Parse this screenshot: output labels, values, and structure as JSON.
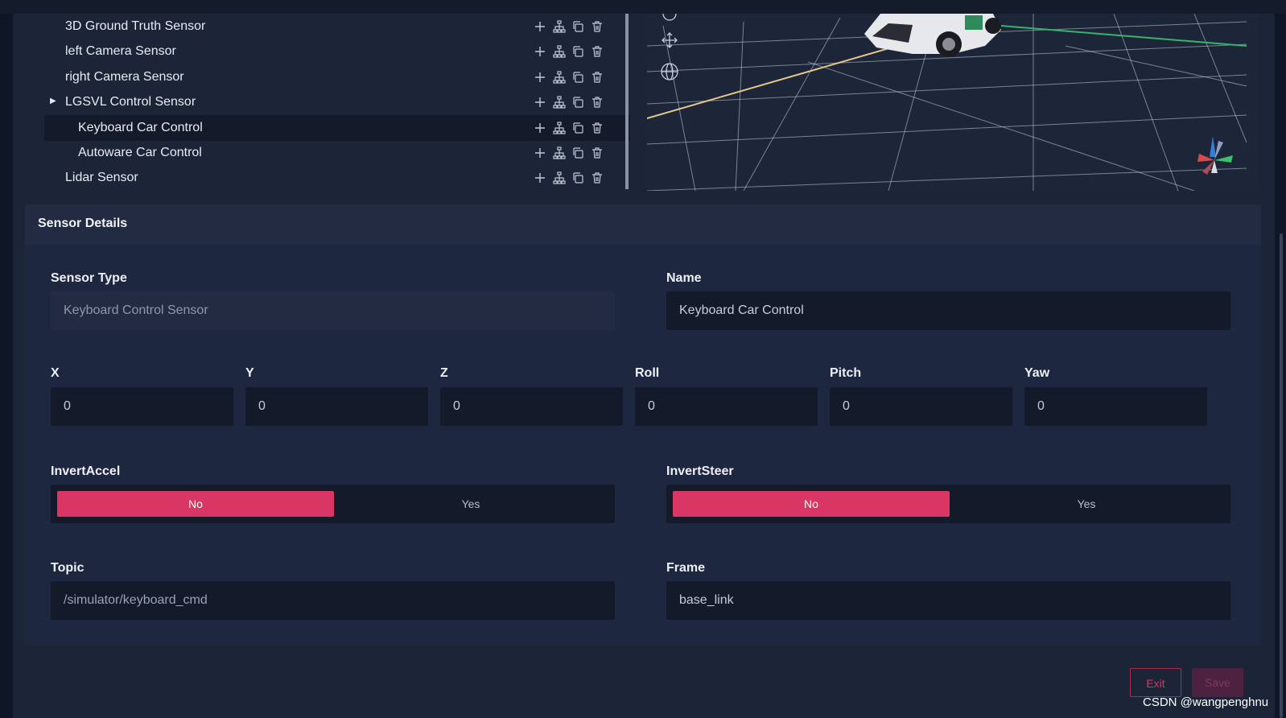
{
  "tree": {
    "items": [
      {
        "label": "3D Ground Truth Sensor",
        "indent": 1,
        "has_children": false,
        "selected": false
      },
      {
        "label": "left Camera Sensor",
        "indent": 1,
        "has_children": false,
        "selected": false
      },
      {
        "label": "right Camera Sensor",
        "indent": 1,
        "has_children": false,
        "selected": false
      },
      {
        "label": "LGSVL Control Sensor",
        "indent": 1,
        "has_children": true,
        "selected": false
      },
      {
        "label": "Keyboard Car Control",
        "indent": 2,
        "has_children": false,
        "selected": true
      },
      {
        "label": "Autoware Car Control",
        "indent": 2,
        "has_children": false,
        "selected": false
      },
      {
        "label": "Lidar Sensor",
        "indent": 1,
        "has_children": false,
        "selected": false
      }
    ],
    "action_icons": [
      "plus-icon",
      "hierarchy-icon",
      "copy-icon",
      "trash-icon"
    ],
    "expand_icon": "caret-right-icon"
  },
  "viewport": {
    "tool_icons": [
      "rotate-icon",
      "move-icon",
      "globe-icon"
    ],
    "gizmo_icon": "axis-gizmo-icon"
  },
  "details": {
    "title": "Sensor Details",
    "sensor_type": {
      "label": "Sensor Type",
      "value": "Keyboard Control Sensor"
    },
    "name": {
      "label": "Name",
      "value": "Keyboard Car Control"
    },
    "transform": [
      {
        "label": "X",
        "value": "0"
      },
      {
        "label": "Y",
        "value": "0"
      },
      {
        "label": "Z",
        "value": "0"
      },
      {
        "label": "Roll",
        "value": "0"
      },
      {
        "label": "Pitch",
        "value": "0"
      },
      {
        "label": "Yaw",
        "value": "0"
      }
    ],
    "invert_accel": {
      "label": "InvertAccel",
      "options": [
        "No",
        "Yes"
      ],
      "selected": "No"
    },
    "invert_steer": {
      "label": "InvertSteer",
      "options": [
        "No",
        "Yes"
      ],
      "selected": "No"
    },
    "topic": {
      "label": "Topic",
      "value": "/simulator/keyboard_cmd"
    },
    "frame": {
      "label": "Frame",
      "value": "base_link"
    }
  },
  "buttons": {
    "exit": "Exit",
    "save": "Save"
  },
  "watermark": "CSDN @wangpenghnu",
  "colors": {
    "accent": "#d93565",
    "background": "#1c2438",
    "panel": "#1e2740",
    "input": "#141a29"
  }
}
